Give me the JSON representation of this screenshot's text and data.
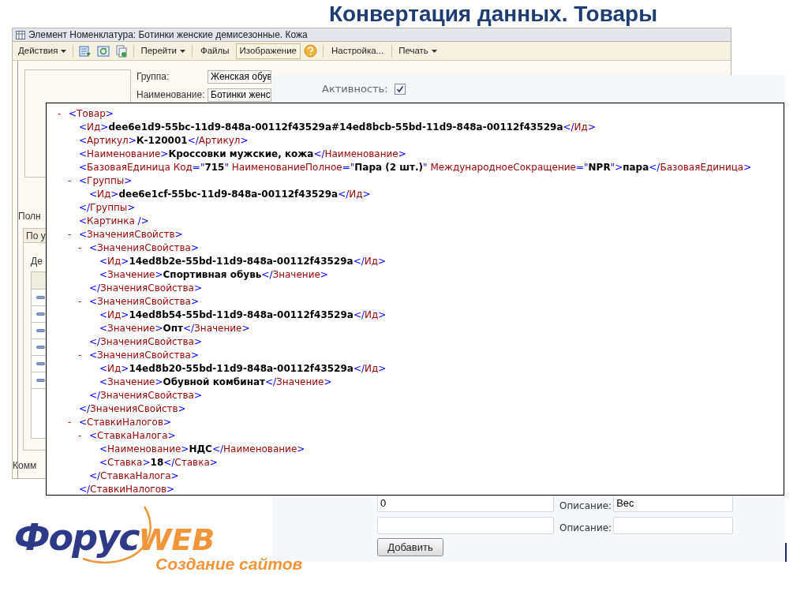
{
  "slide_title": "Конвертация данных. Товары",
  "app_window": {
    "title": "Элемент Номенклатура: Ботинки женские демисезонные. Кожа",
    "toolbar": [
      {
        "kind": "menu",
        "label": "Действия"
      },
      {
        "kind": "separator"
      },
      {
        "kind": "icon"
      },
      {
        "kind": "icon"
      },
      {
        "kind": "icon"
      },
      {
        "kind": "separator"
      },
      {
        "kind": "menu",
        "label": "Перейти"
      },
      {
        "kind": "separator"
      },
      {
        "kind": "button",
        "label": "Файлы",
        "pressed": false
      },
      {
        "kind": "button",
        "label": "Изображение",
        "pressed": true
      },
      {
        "kind": "icon"
      },
      {
        "kind": "separator"
      },
      {
        "kind": "button",
        "label": "Настройка...",
        "pressed": false
      },
      {
        "kind": "separator"
      },
      {
        "kind": "menu",
        "label": "Печать"
      }
    ],
    "fields": [
      {
        "label": "Группа:",
        "value": "Женская обув"
      },
      {
        "label": "Наименование:",
        "value": "Ботинки женс"
      }
    ],
    "full_name_label": "Полн",
    "tab": {
      "label": "По у",
      "selected": true
    },
    "panel_label": "Де",
    "table_rows": [
      {
        "kind": "item"
      },
      {
        "kind": "item"
      },
      {
        "kind": "item"
      },
      {
        "kind": "item"
      },
      {
        "kind": "item"
      },
      {
        "kind": "item"
      }
    ],
    "comment_label": "Комм"
  },
  "web_form": {
    "active": {
      "label": "Активность:",
      "checked": true
    },
    "rows": [
      {
        "value": "0",
        "description_label": "Описание:",
        "description_value": "Вес"
      },
      {
        "description_label": "Описание:"
      }
    ],
    "add_button": "Добавить"
  },
  "xml_view": {
    "root": {
      "toggle": "-",
      "expanded": true,
      "text": "<Товар>",
      "children": [
        {
          "text": "<Ид>**dee6e1d9-55bc-11d9-848a-00112f43529a#14ed8bcb-55bd-11d9-848a-00112f43529a**</Ид>"
        },
        {
          "text": "<Артикул>**К-120001**</Артикул>"
        },
        {
          "text": "<Наименование>**Кроссовки мужские, кожа**</Наименование>"
        },
        {
          "text": "<БазоваяЕдиница Код=\"**715**\" НаименованиеПолное=\"**Пара (2 шт.)**\" МеждународноеСокращение=\"**NPR**\">**пара**</БазоваяЕдиница>"
        },
        {
          "toggle": "-",
          "expanded": true,
          "text": "<Группы>",
          "close": "</Группы>",
          "children": [
            {
              "text": "<Ид>**dee6e1cf-55bc-11d9-848a-00112f43529a**</Ид>"
            }
          ]
        },
        {
          "text": "<Картинка />"
        },
        {
          "toggle": "-",
          "expanded": true,
          "text": "<ЗначенияСвойств>",
          "close": "</ЗначенияСвойств>",
          "children": [
            {
              "toggle": "-",
              "expanded": true,
              "text": "<ЗначенияСвойства>",
              "close": "</ЗначенияСвойства>",
              "children": [
                {
                  "text": "<Ид>**14ed8b2e-55bd-11d9-848a-00112f43529a**</Ид>"
                },
                {
                  "text": "<Значение>**Спортивная обувь**</Значение>"
                }
              ]
            },
            {
              "toggle": "-",
              "expanded": true,
              "text": "<ЗначенияСвойства>",
              "close": "</ЗначенияСвойства>",
              "children": [
                {
                  "text": "<Ид>**14ed8b54-55bd-11d9-848a-00112f43529a**</Ид>"
                },
                {
                  "text": "<Значение>**Опт**</Значение>"
                }
              ]
            },
            {
              "toggle": "-",
              "expanded": true,
              "text": "<ЗначенияСвойства>",
              "close": "</ЗначенияСвойства>",
              "children": [
                {
                  "text": "<Ид>**14ed8b20-55bd-11d9-848a-00112f43529a**</Ид>"
                },
                {
                  "text": "<Значение>**Обувной комбинат**</Значение>"
                }
              ]
            }
          ]
        },
        {
          "toggle": "-",
          "expanded": true,
          "text": "<СтавкиНалогов>",
          "close": "</СтавкиНалогов>",
          "children": [
            {
              "toggle": "-",
              "expanded": true,
              "text": "<СтавкаНалога>",
              "close": "</СтавкаНалога>",
              "children": [
                {
                  "text": "<Наименование>**НДС**</Наименование>"
                },
                {
                  "text": "<Ставка>**18**</Ставка>"
                }
              ]
            }
          ]
        }
      ]
    }
  },
  "logo": {
    "brand_main": "Форус",
    "brand_accent": "WEB",
    "tagline": "Создание сайтов"
  }
}
